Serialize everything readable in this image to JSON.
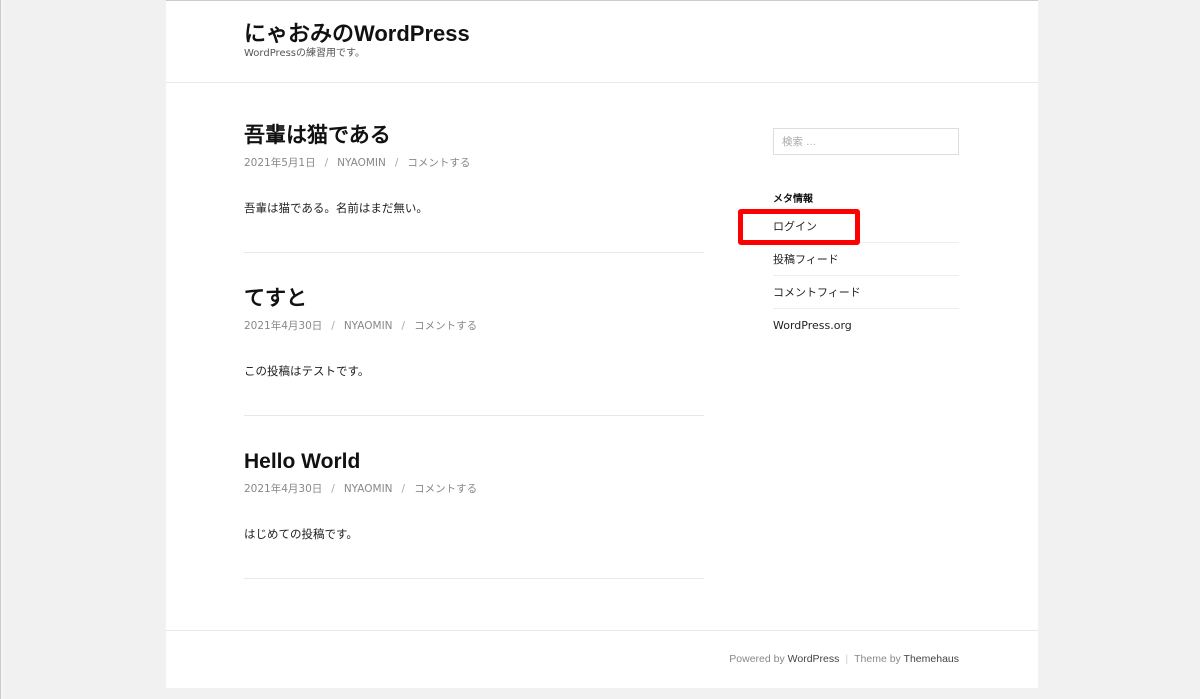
{
  "site": {
    "title": "にゃおみのWordPress",
    "description": "WordPressの練習用です。"
  },
  "posts": [
    {
      "title": "吾輩は猫である",
      "date": "2021年5月1日",
      "author": "NYAOMIN",
      "comment": "コメントする",
      "body": "吾輩は猫である。名前はまだ無い。"
    },
    {
      "title": "てすと",
      "date": "2021年4月30日",
      "author": "NYAOMIN",
      "comment": "コメントする",
      "body": "この投稿はテストです。"
    },
    {
      "title": "Hello World",
      "date": "2021年4月30日",
      "author": "NYAOMIN",
      "comment": "コメントする",
      "body": "はじめての投稿です。"
    }
  ],
  "meta_separator": "/",
  "sidebar": {
    "search_placeholder": "検索 …",
    "meta_title": "メタ情報",
    "meta_links": [
      "ログイン",
      "投稿フィード",
      "コメントフィード",
      "WordPress.org"
    ]
  },
  "footer": {
    "powered_prefix": "Powered by ",
    "powered_link": "WordPress",
    "separator": "|",
    "theme_prefix": "Theme by ",
    "theme_link": "Themehaus"
  },
  "highlight_color": "#ff0000"
}
